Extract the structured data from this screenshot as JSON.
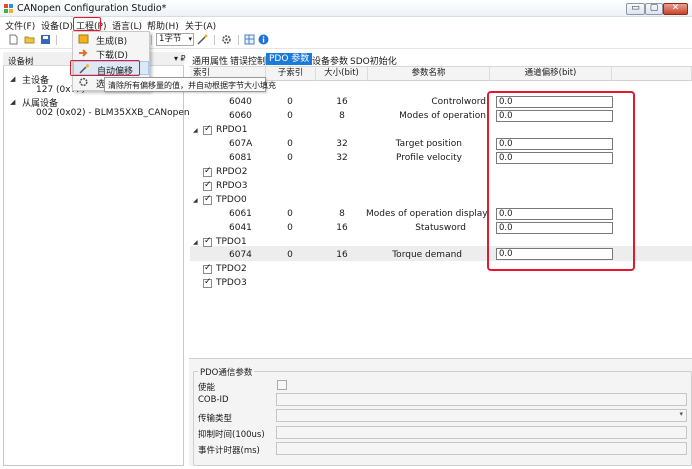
{
  "window": {
    "title": "CANopen Configuration Studio*",
    "controls": {
      "minimize": "▭",
      "maximize": "▢",
      "close": "✕"
    }
  },
  "menu": {
    "file": "文件(F)",
    "device": "设备(D)",
    "project": "工程(P)",
    "language": "语言(L)",
    "help": "帮助(H)",
    "about": "关于(A)"
  },
  "toolbar": {
    "byte_combo": "1字节",
    "combo_arrow": "▾"
  },
  "project_menu": {
    "items": [
      "生成(B)",
      "下载(D)",
      "自动偏移",
      "选"
    ]
  },
  "tooltip": "清除所有偏移量的值，并自动根据字节大小填充",
  "device_tree": {
    "title": "设备树",
    "pin": "▾ ₽",
    "master_label": "主设备",
    "master_node": "127 (0x7F)",
    "slave_label": "从属设备",
    "slave_node": "002 (0x02)  -  BLM35XXB_CANopen"
  },
  "tabs": [
    "通用属性",
    "错误控制",
    "PDO 参数",
    "设备参数",
    "SDO初始化"
  ],
  "pdo_table": {
    "headers": {
      "index": "索引",
      "subindex": "子索引",
      "size": "大小(bit)",
      "name": "参数名称",
      "offset": "通道偏移(bit)"
    },
    "rows": [
      {
        "type": "entry",
        "index": "6040",
        "subindex": "0",
        "size": "16",
        "name": "Controlword",
        "offset": "0.0"
      },
      {
        "type": "entry",
        "index": "6060",
        "subindex": "0",
        "size": "8",
        "name": "Modes of operation",
        "offset": "0.0"
      },
      {
        "type": "group",
        "label": "RPDO1",
        "checked": true,
        "expanded": true
      },
      {
        "type": "entry",
        "index": "607A",
        "subindex": "0",
        "size": "32",
        "name": "Target position",
        "offset": "0.0"
      },
      {
        "type": "entry",
        "index": "6081",
        "subindex": "0",
        "size": "32",
        "name": "Profile velocity",
        "offset": "0.0"
      },
      {
        "type": "group",
        "label": "RPDO2",
        "checked": true,
        "expanded": false
      },
      {
        "type": "group",
        "label": "RPDO3",
        "checked": true,
        "expanded": false
      },
      {
        "type": "group",
        "label": "TPDO0",
        "checked": true,
        "expanded": true
      },
      {
        "type": "entry",
        "index": "6061",
        "subindex": "0",
        "size": "8",
        "name": "Modes of operation display",
        "offset": "0.0"
      },
      {
        "type": "entry",
        "index": "6041",
        "subindex": "0",
        "size": "16",
        "name": "Statusword",
        "offset": "0.0"
      },
      {
        "type": "group",
        "label": "TPDO1",
        "checked": true,
        "expanded": true
      },
      {
        "type": "entry",
        "index": "6074",
        "subindex": "0",
        "size": "16",
        "name": "Torque demand",
        "offset": "0.0",
        "selected": true
      },
      {
        "type": "group",
        "label": "TPDO2",
        "checked": true,
        "expanded": false
      },
      {
        "type": "group",
        "label": "TPDO3",
        "checked": true,
        "expanded": false
      }
    ]
  },
  "pdo_params": {
    "group_title": "PDO通信参数",
    "enable": "使能",
    "cob_id": "COB-ID",
    "transmission_type": "传输类型",
    "inhibit_time": "抑制时间(100us)",
    "event_timer": "事件计时器(ms)"
  },
  "colors": {
    "highlight_red": "#e3182d",
    "active_tab": "#1c7ad9"
  }
}
